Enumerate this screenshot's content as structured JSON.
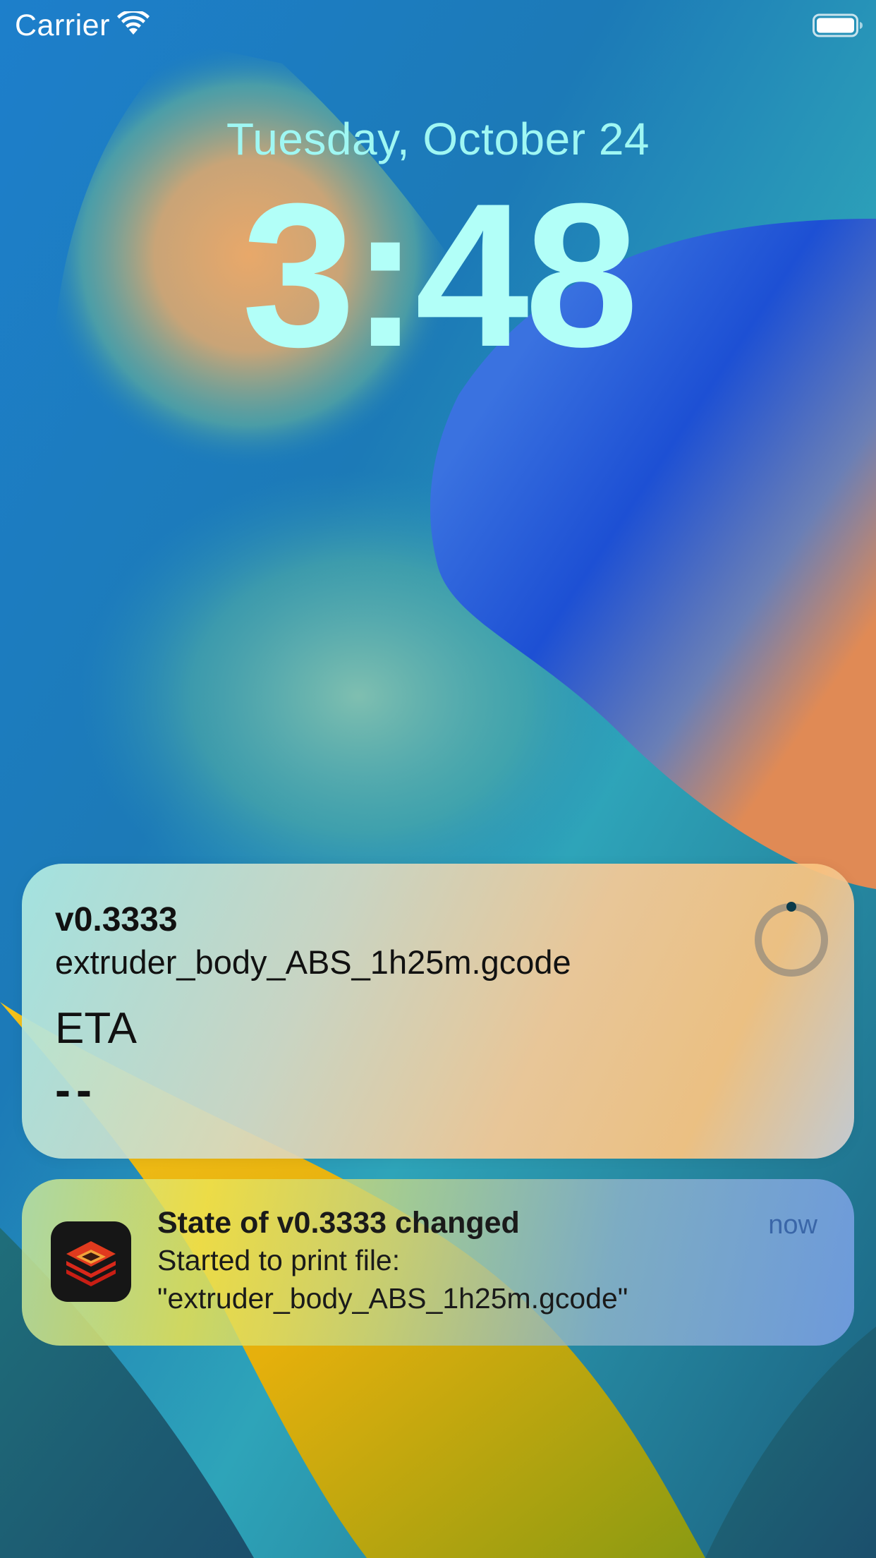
{
  "status_bar": {
    "carrier": "Carrier",
    "wifi_icon": "wifi-icon",
    "battery_icon": "battery-icon"
  },
  "lock_screen": {
    "date": "Tuesday, October 24",
    "time": "3:48"
  },
  "live_activity": {
    "printer_name": "v0.3333",
    "file_name": "extruder_body_ABS_1h25m.gcode",
    "eta_label": "ETA",
    "eta_value": "--",
    "progress": 0,
    "progress_icon": "progress-ring-icon"
  },
  "notification": {
    "app_icon": "printer-app-icon",
    "title": "State of v0.3333 changed",
    "time": "now",
    "body_line_1": "Started to print file:",
    "body_line_2": "\"extruder_body_ABS_1h25m.gcode\""
  },
  "colors": {
    "date_text": "#9ff7f3",
    "clock_text": "#b2fff8",
    "notification_time": "#3a66a8"
  }
}
